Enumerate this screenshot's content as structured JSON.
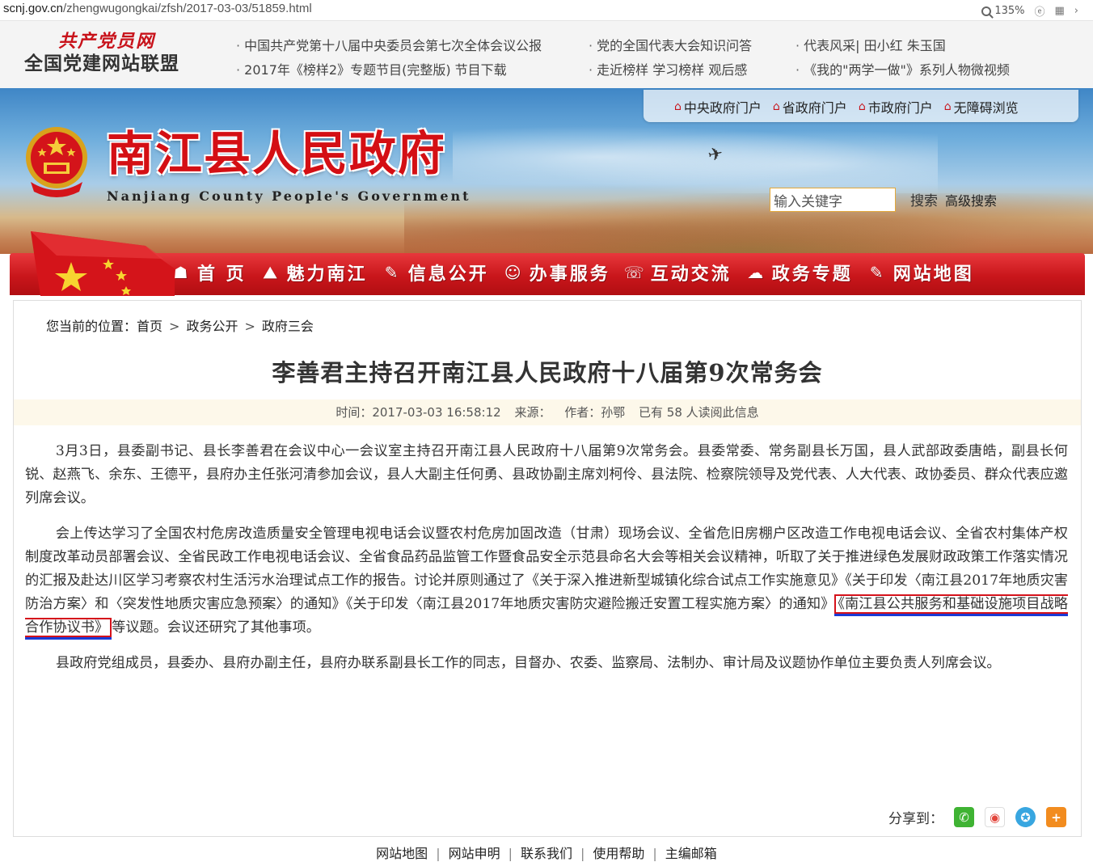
{
  "browser": {
    "url_host": "scnj.gov.cn",
    "url_path": "/zhengwugongkai/zfsh/2017-03-03/51859.html",
    "zoom": "135%"
  },
  "league": {
    "slogan": "共产党员网",
    "name": "全国党建网站联盟",
    "links_col1": [
      "中国共产党第十八届中央委员会第七次全体会议公报",
      "2017年《榜样2》专题节目(完整版) 节目下载"
    ],
    "links_col2": [
      "党的全国代表大会知识问答",
      "走近榜样 学习榜样 观后感"
    ],
    "links_col3": [
      "代表风采| 田小红 朱玉国",
      "《我的\"两学一做\"》系列人物微视频"
    ]
  },
  "header": {
    "title": "南江县人民政府",
    "subtitle": "Nanjiang County People's Government",
    "portals": [
      "中央政府门户",
      "省政府门户",
      "市政府门户",
      "无障碍浏览"
    ],
    "search_value": "输入关键字",
    "search_button": "搜索",
    "advanced_search": "高级搜索"
  },
  "nav": {
    "items": [
      {
        "label": "首 页",
        "icon": "home-icon"
      },
      {
        "label": "魅力南江",
        "icon": "scenery-icon"
      },
      {
        "label": "信息公开",
        "icon": "edit-icon"
      },
      {
        "label": "办事服务",
        "icon": "service-icon"
      },
      {
        "label": "互动交流",
        "icon": "chat-icon"
      },
      {
        "label": "政务专题",
        "icon": "topic-icon"
      },
      {
        "label": "网站地图",
        "icon": "map-icon"
      }
    ]
  },
  "breadcrumb": {
    "prefix": "您当前的位置：",
    "items": [
      "首页",
      "政务公开",
      "政府三会"
    ]
  },
  "article": {
    "title": "李善君主持召开南江县人民政府十八届第9次常务会",
    "time_label": "时间：2017-03-03 16:58:12",
    "source_label": "来源：",
    "author_label": "作者：孙鄂",
    "reads_label": "已有 58 人读阅此信息",
    "p1": "3月3日，县委副书记、县长李善君在会议中心一会议室主持召开南江县人民政府十八届第9次常务会。县委常委、常务副县长万国，县人武部政委唐皓，副县长何锐、赵燕飞、余东、王德平，县府办主任张河清参加会议，县人大副主任何勇、县政协副主席刘柯伶、县法院、检察院领导及党代表、人大代表、政协委员、群众代表应邀列席会议。",
    "p2_before": "会上传达学习了全国农村危房改造质量安全管理电视电话会议暨农村危房加固改造（甘肃）现场会议、全省危旧房棚户区改造工作电视电话会议、全省农村集体产权制度改革动员部署会议、全省民政工作电视电话会议、全省食品药品监管工作暨食品安全示范县命名大会等相关会议精神，听取了关于推进绿色发展财政政策工作落实情况的汇报及赴达川区学习考察农村生活污水治理试点工作的报告。讨论并原则通过了《关于深入推进新型城镇化综合试点工作实施意见》《关于印发〈南江县2017年地质灾害防治方案〉和〈突发性地质灾害应急预案〉的通知》《关于印发〈南江县2017年地质灾害防灾避险搬迁安置工程实施方案〉的通知》",
    "p2_highlight": "《南江县公共服务和基础设施项目战略合作协议书》",
    "p2_after": "等议题。会议还研究了其他事项。",
    "p3": "县政府党组成员，县委办、县府办副主任，县府办联系副县长工作的同志，目督办、农委、监察局、法制办、审计局及议题协作单位主要负责人列席会议。",
    "share_label": "分享到："
  },
  "footer": {
    "links": [
      "网站地图",
      "网站申明",
      "联系我们",
      "使用帮助",
      "主编邮箱"
    ]
  },
  "colors": {
    "brand_red": "#c9161b",
    "highlight_box": "#d5121b",
    "highlight_underline": "#1a3bd6"
  }
}
